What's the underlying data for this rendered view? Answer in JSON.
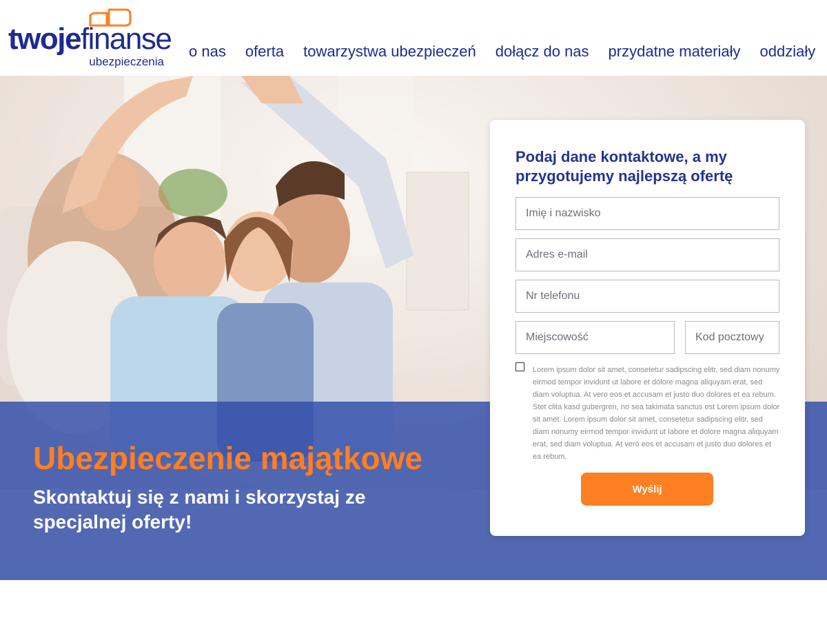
{
  "brand": {
    "name_bold": "twoje",
    "name_light": "finanse",
    "sub": "ubezpieczenia",
    "colors": {
      "navy": "#1e2b8f",
      "orange": "#ff7f22",
      "band": "#2f4ca8"
    }
  },
  "nav": {
    "items": [
      "o nas",
      "oferta",
      "towarzystwa ubezpieczeń",
      "dołącz do nas",
      "przydatne materiały",
      "oddziały"
    ]
  },
  "hero": {
    "title": "Ubezpieczenie majątkowe",
    "subtitle": "Skontaktuj się z nami i skorzystaj ze specjalnej oferty!"
  },
  "form": {
    "title": "Podaj dane kontaktowe, a my przygotujemy najlepszą ofertę",
    "fields": {
      "name": "Imię i nazwisko",
      "email": "Adres e-mail",
      "phone": "Nr telefonu",
      "city": "Miejscowość",
      "zip": "Kod pocztowy"
    },
    "consent": "Lorem ipsum dolor sit amet, consetetur sadipscing elitr, sed diam nonumy eirmod tempor invidunt ut labore et dolore magna aliquyam erat, sed diam voluptua. At vero eos et accusam et justo duo dolores et ea rebum. Stet clita kasd gubergren, no sea takimata sanctus est Lorem ipsum dolor sit amet. Lorem ipsum dolor sit amet, consetetur sadipscing elitr, sed diam nonumy eirmod tempor invidunt ut labore et dolore magna aliquyam erat, sed diam voluptua. At vero eos et accusam et justo duo dolores et ea rebum.",
    "consent_checked": false,
    "submit": "Wyślij"
  }
}
